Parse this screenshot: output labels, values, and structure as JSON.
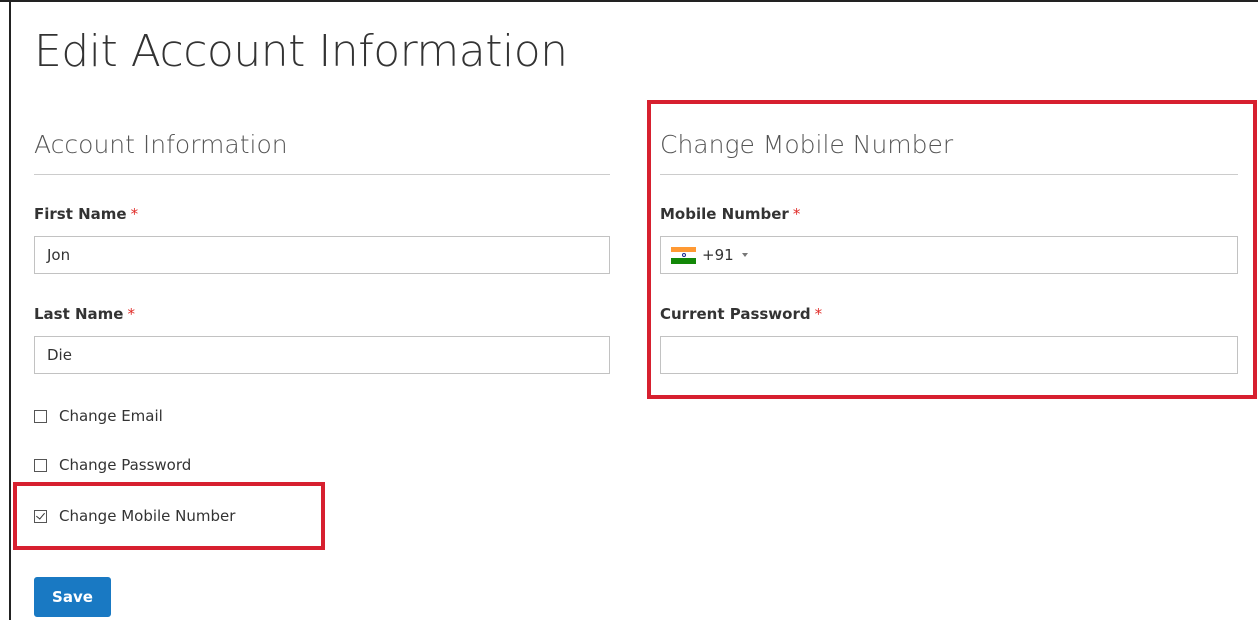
{
  "page": {
    "title": "Edit Account Information"
  },
  "account_info": {
    "section_title": "Account Information",
    "first_name": {
      "label": "First Name",
      "required_mark": "*",
      "value": "Jon"
    },
    "last_name": {
      "label": "Last Name",
      "required_mark": "*",
      "value": "Die"
    },
    "options": [
      {
        "label": "Change Email",
        "checked": false
      },
      {
        "label": "Change Password",
        "checked": false
      },
      {
        "label": "Change Mobile Number",
        "checked": true
      }
    ],
    "save_label": "Save"
  },
  "change_mobile": {
    "section_title": "Change Mobile Number",
    "mobile_number": {
      "label": "Mobile Number",
      "required_mark": "*",
      "country_flag_icon": "india-flag-icon",
      "dial_code": "+91",
      "value": ""
    },
    "current_password": {
      "label": "Current Password",
      "required_mark": "*",
      "value": ""
    }
  },
  "colors": {
    "accent": "#1979c3",
    "highlight": "#d7202f",
    "required": "#e02b27",
    "flag_saffron": "#ff9933",
    "flag_white": "#ffffff",
    "flag_green": "#138808",
    "flag_chakra": "#1e2d8f"
  }
}
